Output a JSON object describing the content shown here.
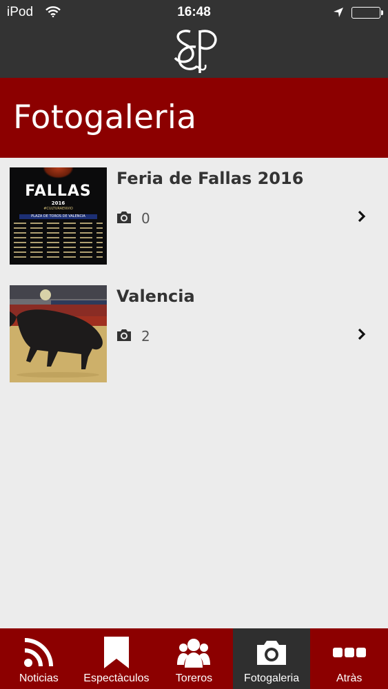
{
  "status_bar": {
    "carrier": "iPod",
    "time": "16:48"
  },
  "header": {
    "title": "Fotogaleria"
  },
  "galleries": [
    {
      "title": "Feria de Fallas 2016",
      "photo_count": "0"
    },
    {
      "title": "Valencia",
      "photo_count": "2"
    }
  ],
  "poster": {
    "title": "FALLAS",
    "year": "2016",
    "tag": "#CULTURAENVIO",
    "band": "PLAZA DE TOROS DE VALENCIA"
  },
  "tabs": [
    {
      "label": "Noticias",
      "icon": "rss-icon"
    },
    {
      "label": "Espectàculos",
      "icon": "bookmark-icon"
    },
    {
      "label": "Toreros",
      "icon": "users-icon"
    },
    {
      "label": "Fotogaleria",
      "icon": "camera-icon"
    },
    {
      "label": "Atràs",
      "icon": "more-icon"
    }
  ],
  "colors": {
    "brand": "#8c0000",
    "header_dark": "#333333",
    "active_tab": "#2f2f2f",
    "background": "#ececec"
  }
}
